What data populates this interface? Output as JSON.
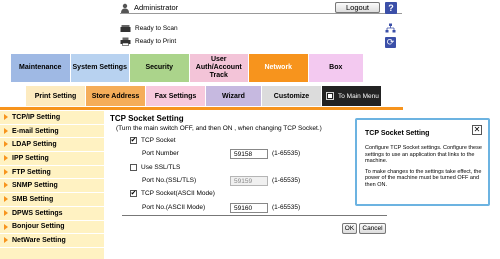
{
  "header": {
    "user": "Administrator",
    "logout_label": "Logout",
    "help_label": "?",
    "scan_status": "Ready to Scan",
    "print_status": "Ready to Print",
    "refresh_label": "⟳"
  },
  "main_tabs": [
    {
      "label": "Maintenance"
    },
    {
      "label": "System Settings"
    },
    {
      "label": "Security"
    },
    {
      "label": "User Auth/Account Track"
    },
    {
      "label": "Network"
    },
    {
      "label": "Box"
    }
  ],
  "sub_tabs": [
    {
      "label": "Print Setting"
    },
    {
      "label": "Store Address"
    },
    {
      "label": "Fax Settings"
    },
    {
      "label": "Wizard"
    },
    {
      "label": "Customize"
    },
    {
      "label": "To Main Menu"
    }
  ],
  "sidebar": {
    "items": [
      {
        "label": "TCP/IP Setting"
      },
      {
        "label": "E-mail Setting"
      },
      {
        "label": "LDAP Setting"
      },
      {
        "label": "IPP Setting"
      },
      {
        "label": "FTP Setting"
      },
      {
        "label": "SNMP Setting"
      },
      {
        "label": "SMB Setting"
      },
      {
        "label": "DPWS Settings"
      },
      {
        "label": "Bonjour Setting"
      },
      {
        "label": "NetWare Setting"
      }
    ]
  },
  "content": {
    "title": "TCP Socket Setting",
    "note": "(Turn the main switch OFF, and then ON , when changing TCP Socket.)",
    "tcp_socket": {
      "label": "TCP Socket",
      "checked": true
    },
    "port_number": {
      "label": "Port Number",
      "value": "59158",
      "range": "(1-65535)"
    },
    "ssl": {
      "label": "Use SSL/TLS",
      "checked": false
    },
    "port_ssl": {
      "label": "Port No.(SSL/TLS)",
      "value": "59159",
      "range": "(1-65535)"
    },
    "ascii": {
      "label": "TCP Socket(ASCII Mode)",
      "checked": true
    },
    "port_ascii": {
      "label": "Port No.(ASCII Mode)",
      "value": "59160",
      "range": "(1-65535)"
    },
    "ok_label": "OK",
    "cancel_label": "Cancel"
  },
  "help_panel": {
    "title": "TCP Socket Setting",
    "close_label": "✕",
    "para1": "Configure TCP Socket settings. Configure these settings to use an application that links to the machine.",
    "para2": "To make changes to the settings take effect, the power of the machine must be turned OFF and then ON."
  },
  "colors": {
    "accent": "#f7941d",
    "sidebar_bg": "#fff2c2",
    "help_border": "#6cb3e1",
    "icon_blue": "#3b4fa8"
  }
}
